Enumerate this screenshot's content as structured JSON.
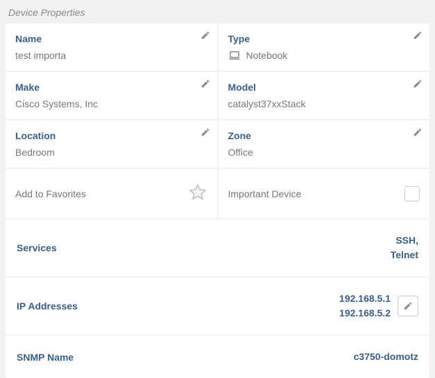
{
  "sectionTitle": "Device Properties",
  "fields": {
    "name": {
      "label": "Name",
      "value": "test importa"
    },
    "type": {
      "label": "Type",
      "value": "Notebook"
    },
    "make": {
      "label": "Make",
      "value": "Cisco Systems, Inc"
    },
    "model": {
      "label": "Model",
      "value": "catalyst37xxStack"
    },
    "location": {
      "label": "Location",
      "value": "Bedroom"
    },
    "zone": {
      "label": "Zone",
      "value": "Office"
    }
  },
  "favorites": {
    "label": "Add to Favorites"
  },
  "important": {
    "label": "Important Device"
  },
  "services": {
    "label": "Services",
    "value": "SSH,\nTelnet"
  },
  "ip": {
    "label": "IP Addresses",
    "line1": "192.168.5.1",
    "line2": "192.168.5.2"
  },
  "snmp": {
    "label": "SNMP Name",
    "value": "c3750-domotz"
  }
}
